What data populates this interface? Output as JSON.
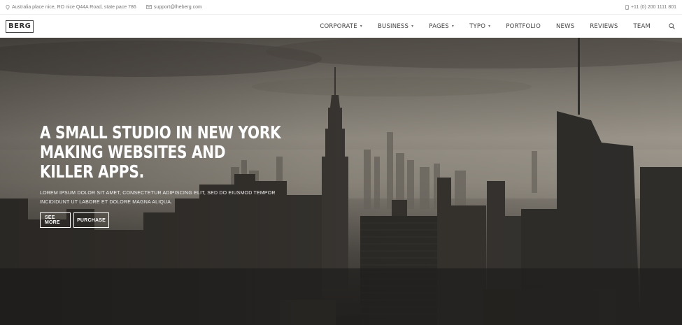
{
  "topbar": {
    "address": "Australia place nice, RO nice Q44A Road, state pace 786",
    "email": "support@lheberg.com",
    "phone": "+11 (0) 200 1111 801"
  },
  "navbar": {
    "logo": "BERG",
    "items": [
      {
        "label": "Corporate",
        "dropdown": true
      },
      {
        "label": "Business",
        "dropdown": true
      },
      {
        "label": "Pages",
        "dropdown": true
      },
      {
        "label": "Typo",
        "dropdown": true
      },
      {
        "label": "Portfolio",
        "dropdown": false
      },
      {
        "label": "News",
        "dropdown": false
      },
      {
        "label": "Reviews",
        "dropdown": false
      },
      {
        "label": "Team",
        "dropdown": false
      }
    ],
    "search_icon": "search-icon"
  },
  "hero": {
    "title": "A small studio in New York making websites and killer apps.",
    "text": "Lorem ipsum dolor sit amet, consectetur adipiscing elit, sed do eiusmod tempor incididunt ut labore et dolore magna aliqua.",
    "buttons": {
      "see_more": "See More",
      "purchase": "Purchase"
    }
  },
  "colors": {
    "text_light": "#ffffff",
    "nav_text": "#444444"
  }
}
